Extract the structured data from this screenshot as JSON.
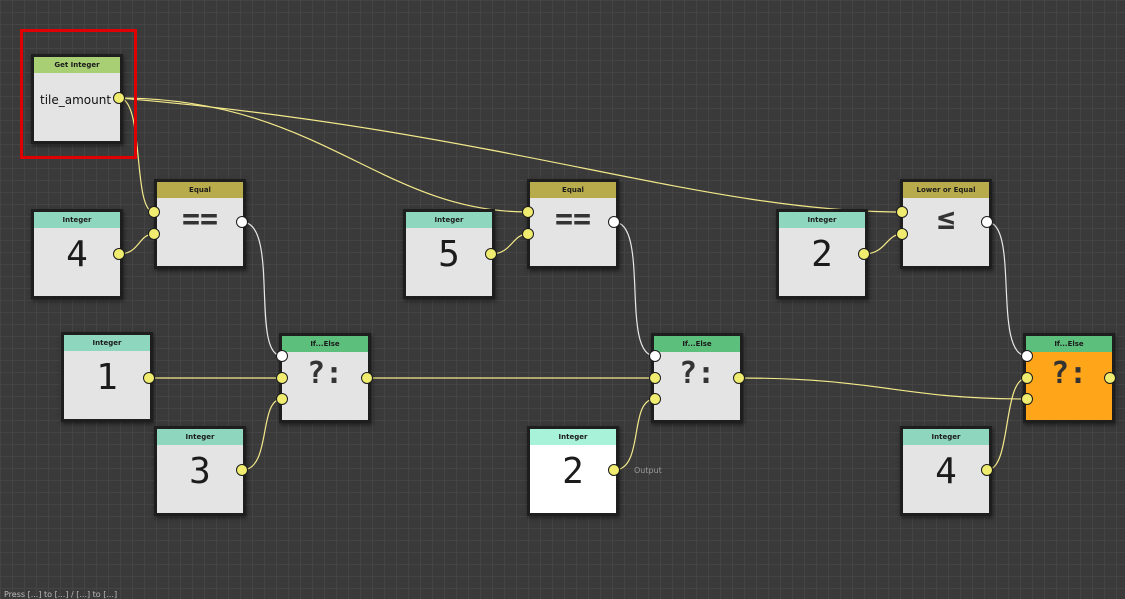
{
  "canvas": {
    "output_label": "Output",
    "status_text": "Press [...] to [...] / [...] to [...]"
  },
  "nodes": {
    "get_integer": {
      "header": "Get Integer",
      "variable": "tile_amount"
    },
    "equal_1": {
      "header": "Equal",
      "operator": "=="
    },
    "equal_2": {
      "header": "Equal",
      "operator": "=="
    },
    "lower_or_equal": {
      "header": "Lower or Equal",
      "operator": "≤"
    },
    "integer_4_a": {
      "header": "Integer",
      "value": "4"
    },
    "integer_5": {
      "header": "Integer",
      "value": "5"
    },
    "integer_2_a": {
      "header": "Integer",
      "value": "2"
    },
    "integer_1": {
      "header": "Integer",
      "value": "1"
    },
    "integer_3": {
      "header": "Integer",
      "value": "3"
    },
    "integer_2_output": {
      "header": "Integer",
      "value": "2"
    },
    "integer_4_b": {
      "header": "Integer",
      "value": "4"
    },
    "if_else_1": {
      "header": "If...Else",
      "operator": "?:"
    },
    "if_else_2": {
      "header": "If...Else",
      "operator": "?:"
    },
    "if_else_3": {
      "header": "If...Else",
      "operator": "?:",
      "selected_color": "#ffa51a"
    }
  },
  "colors": {
    "canvas_bg": "#3a3a3a",
    "wire_data": "#f3e98a",
    "wire_bool": "#e8e8e8",
    "selection": "#e00000"
  }
}
